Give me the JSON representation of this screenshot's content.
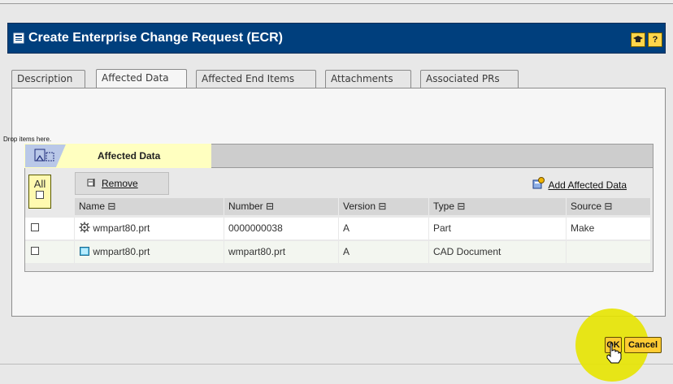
{
  "window": {
    "title": "Create Enterprise Change Request (ECR)",
    "help_button": "?"
  },
  "tabs": [
    {
      "label": "Description",
      "active": false
    },
    {
      "label": "Affected Data",
      "active": true
    },
    {
      "label": "Affected End Items",
      "active": false
    },
    {
      "label": "Attachments",
      "active": false
    },
    {
      "label": "Associated PRs",
      "active": false
    }
  ],
  "drop_hint": "Drop items here.",
  "affected_data": {
    "title": "Affected Data",
    "select_all_label": "All",
    "remove_label": "Remove",
    "add_label": "Add Affected Data",
    "columns": [
      "Name ⊟",
      "Number ⊟",
      "Version ⊟",
      "Type ⊟",
      "Source ⊟"
    ],
    "rows": [
      {
        "icon": "gear-part-icon",
        "name": "wmpart80.prt",
        "number": "0000000038",
        "version": "A",
        "type": "Part",
        "source": "Make"
      },
      {
        "icon": "cad-document-icon",
        "name": "wmpart80.prt",
        "number": "wmpart80.prt",
        "version": "A",
        "type": "CAD Document",
        "source": ""
      }
    ]
  },
  "footer": {
    "ok_label": "OK",
    "cancel_label": "Cancel"
  },
  "colors": {
    "titlebar": "#003f7d",
    "accent_button": "#ffcc33",
    "affected_tab": "#ffffc0",
    "cursor_highlight": "#e7e400"
  }
}
